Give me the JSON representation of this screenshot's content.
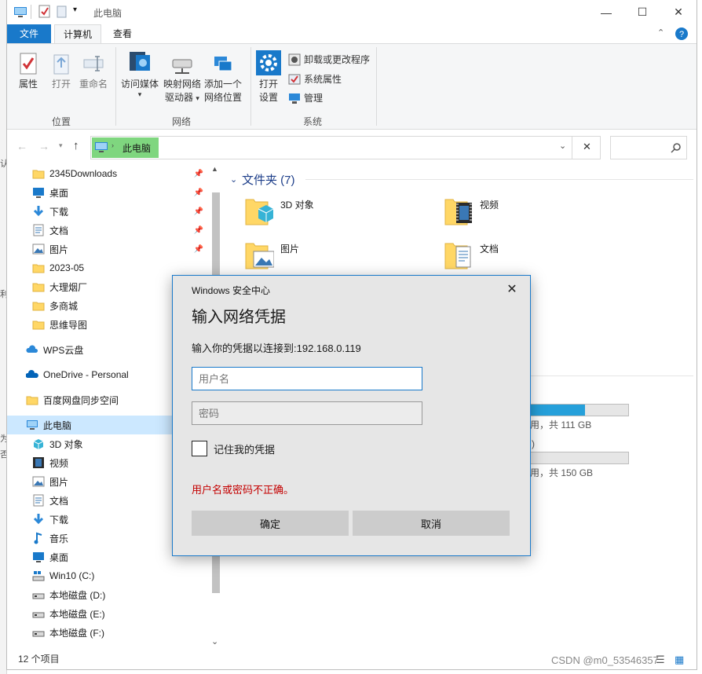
{
  "window": {
    "title": "此电脑",
    "controls": {
      "minimize": "—",
      "maximize": "☐",
      "close": "✕"
    }
  },
  "tabs": {
    "file": "文件",
    "computer": "计算机",
    "view": "查看"
  },
  "ribbon": {
    "location": {
      "group_label": "位置",
      "properties": "属性",
      "open": "打开",
      "rename": "重命名"
    },
    "network": {
      "group_label": "网络",
      "media": "访问媒体",
      "map_drive_1": "映射网络",
      "map_drive_2": "驱动器",
      "add_location_1": "添加一个",
      "add_location_2": "网络位置"
    },
    "system": {
      "group_label": "系统",
      "open_settings_1": "打开",
      "open_settings_2": "设置",
      "uninstall": "卸载或更改程序",
      "sys_props": "系统属性",
      "manage": "管理"
    }
  },
  "address": {
    "path": "此电脑"
  },
  "nav": {
    "quick": [
      {
        "label": "2345Downloads",
        "icon": "folder-icon"
      },
      {
        "label": "桌面",
        "icon": "desktop-icon"
      },
      {
        "label": "下载",
        "icon": "download-icon"
      },
      {
        "label": "文档",
        "icon": "document-icon"
      },
      {
        "label": "图片",
        "icon": "picture-icon"
      },
      {
        "label": "2023-05",
        "icon": "folder-icon"
      },
      {
        "label": "大理烟厂",
        "icon": "folder-icon"
      },
      {
        "label": "多商城",
        "icon": "folder-icon"
      },
      {
        "label": "思维导图",
        "icon": "folder-icon"
      }
    ],
    "wps": "WPS云盘",
    "onedrive": "OneDrive - Personal",
    "baidu": "百度网盘同步空间",
    "thispc": "此电脑",
    "pc_items": [
      {
        "label": "3D 对象",
        "icon": "3d-objects-icon"
      },
      {
        "label": "视频",
        "icon": "video-icon"
      },
      {
        "label": "图片",
        "icon": "picture-icon"
      },
      {
        "label": "文档",
        "icon": "document-icon"
      },
      {
        "label": "下载",
        "icon": "download-icon"
      },
      {
        "label": "音乐",
        "icon": "music-icon"
      },
      {
        "label": "桌面",
        "icon": "desktop-icon"
      },
      {
        "label": "Win10 (C:)",
        "icon": "system-drive-icon"
      },
      {
        "label": "本地磁盘 (D:)",
        "icon": "drive-icon"
      },
      {
        "label": "本地磁盘 (E:)",
        "icon": "drive-icon"
      },
      {
        "label": "本地磁盘 (F:)",
        "icon": "drive-icon"
      }
    ]
  },
  "content": {
    "folders_header": "文件夹 (7)",
    "folders": [
      {
        "label": "3D 对象",
        "icon": "3d-objects-icon"
      },
      {
        "label": "视频",
        "icon": "video-icon"
      },
      {
        "label": "图片",
        "icon": "picture-icon"
      },
      {
        "label": "文档",
        "icon": "document-icon"
      }
    ],
    "drive1_text": "用，共 111 GB",
    "drive1_fill": 0.56,
    "drive2_text": "用，共 150 GB",
    "drive2_fill": 0.0,
    "drive2_partial": ")"
  },
  "status": {
    "count": "12 个项目"
  },
  "watermark": "CSDN @m0_53546357",
  "dialog": {
    "header": "Windows 安全中心",
    "title": "输入网络凭据",
    "message": "输入你的凭据以连接到:192.168.0.119",
    "username_placeholder": "用户名",
    "password_placeholder": "密码",
    "remember": "记住我的凭据",
    "error": "用户名或密码不正确。",
    "ok": "确定",
    "cancel": "取消"
  },
  "colors": {
    "accent": "#1979ca",
    "error": "#c40000",
    "selection": "#cce8ff"
  }
}
